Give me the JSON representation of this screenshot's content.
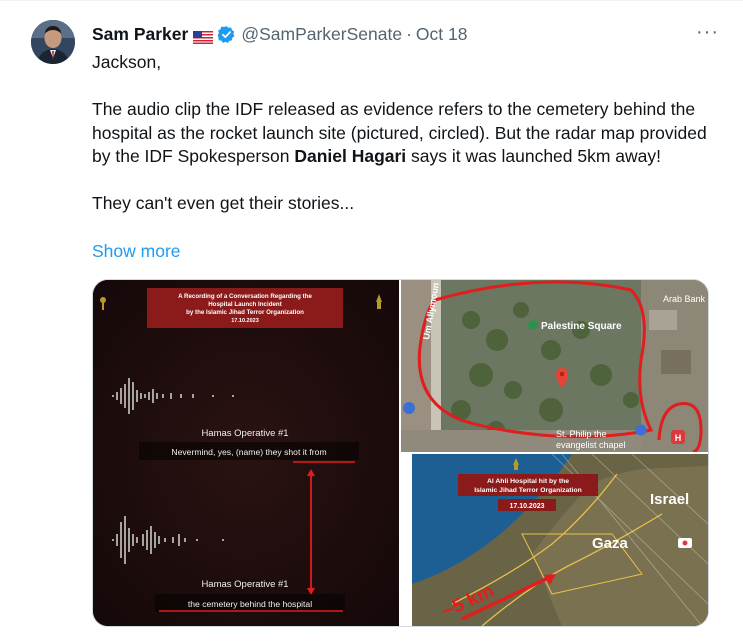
{
  "tweet": {
    "author_name": "Sam Parker",
    "handle": "@SamParkerSenate",
    "separator": "·",
    "date": "Oct 18",
    "more_label": "···",
    "text": {
      "line1": "Jackson,",
      "p2_part1": "The audio clip the IDF released as evidence refers to the cemetery behind the hospital as the rocket launch site (pictured, circled). But the radar map provided by the IDF Spokesperson ",
      "p2_bold": "Daniel Hagari",
      "p2_part2": " says it was launched 5km away!",
      "p3": "They can't even get their stories..."
    },
    "show_more": "Show more"
  },
  "media": {
    "image1": {
      "title_line1": "A Recording of a Conversation Regarding the",
      "title_line2": "Hospital Launch Incident",
      "title_line3": "by the Islamic Jihad Terror Organization",
      "title_date": "17.10.2023",
      "speaker1": "Hamas Operative #1",
      "caption1": "Nevermind, yes, (name) they shot it from",
      "speaker2": "Hamas Operative #1",
      "caption2": "the cemetery behind the hospital"
    },
    "image2": {
      "street_label": "Um Allymoun",
      "place_label": "Palestine Square",
      "bank_label": "Arab Bank",
      "chapel_line1": "St. Philip the",
      "chapel_line2": "evangelist chapel"
    },
    "image3": {
      "title_line1": "Al Ahli Hospital hit by the",
      "title_line2": "Islamic Jihad Terror Organization",
      "date": "17.10.2023",
      "label_israel": "Israel",
      "label_gaza": "Gaza",
      "distance": "~5 km"
    }
  },
  "colors": {
    "accent_blue": "#1d9bf0",
    "annotation_red": "#e11d1d",
    "title_banner_red": "#8b1a1a"
  }
}
